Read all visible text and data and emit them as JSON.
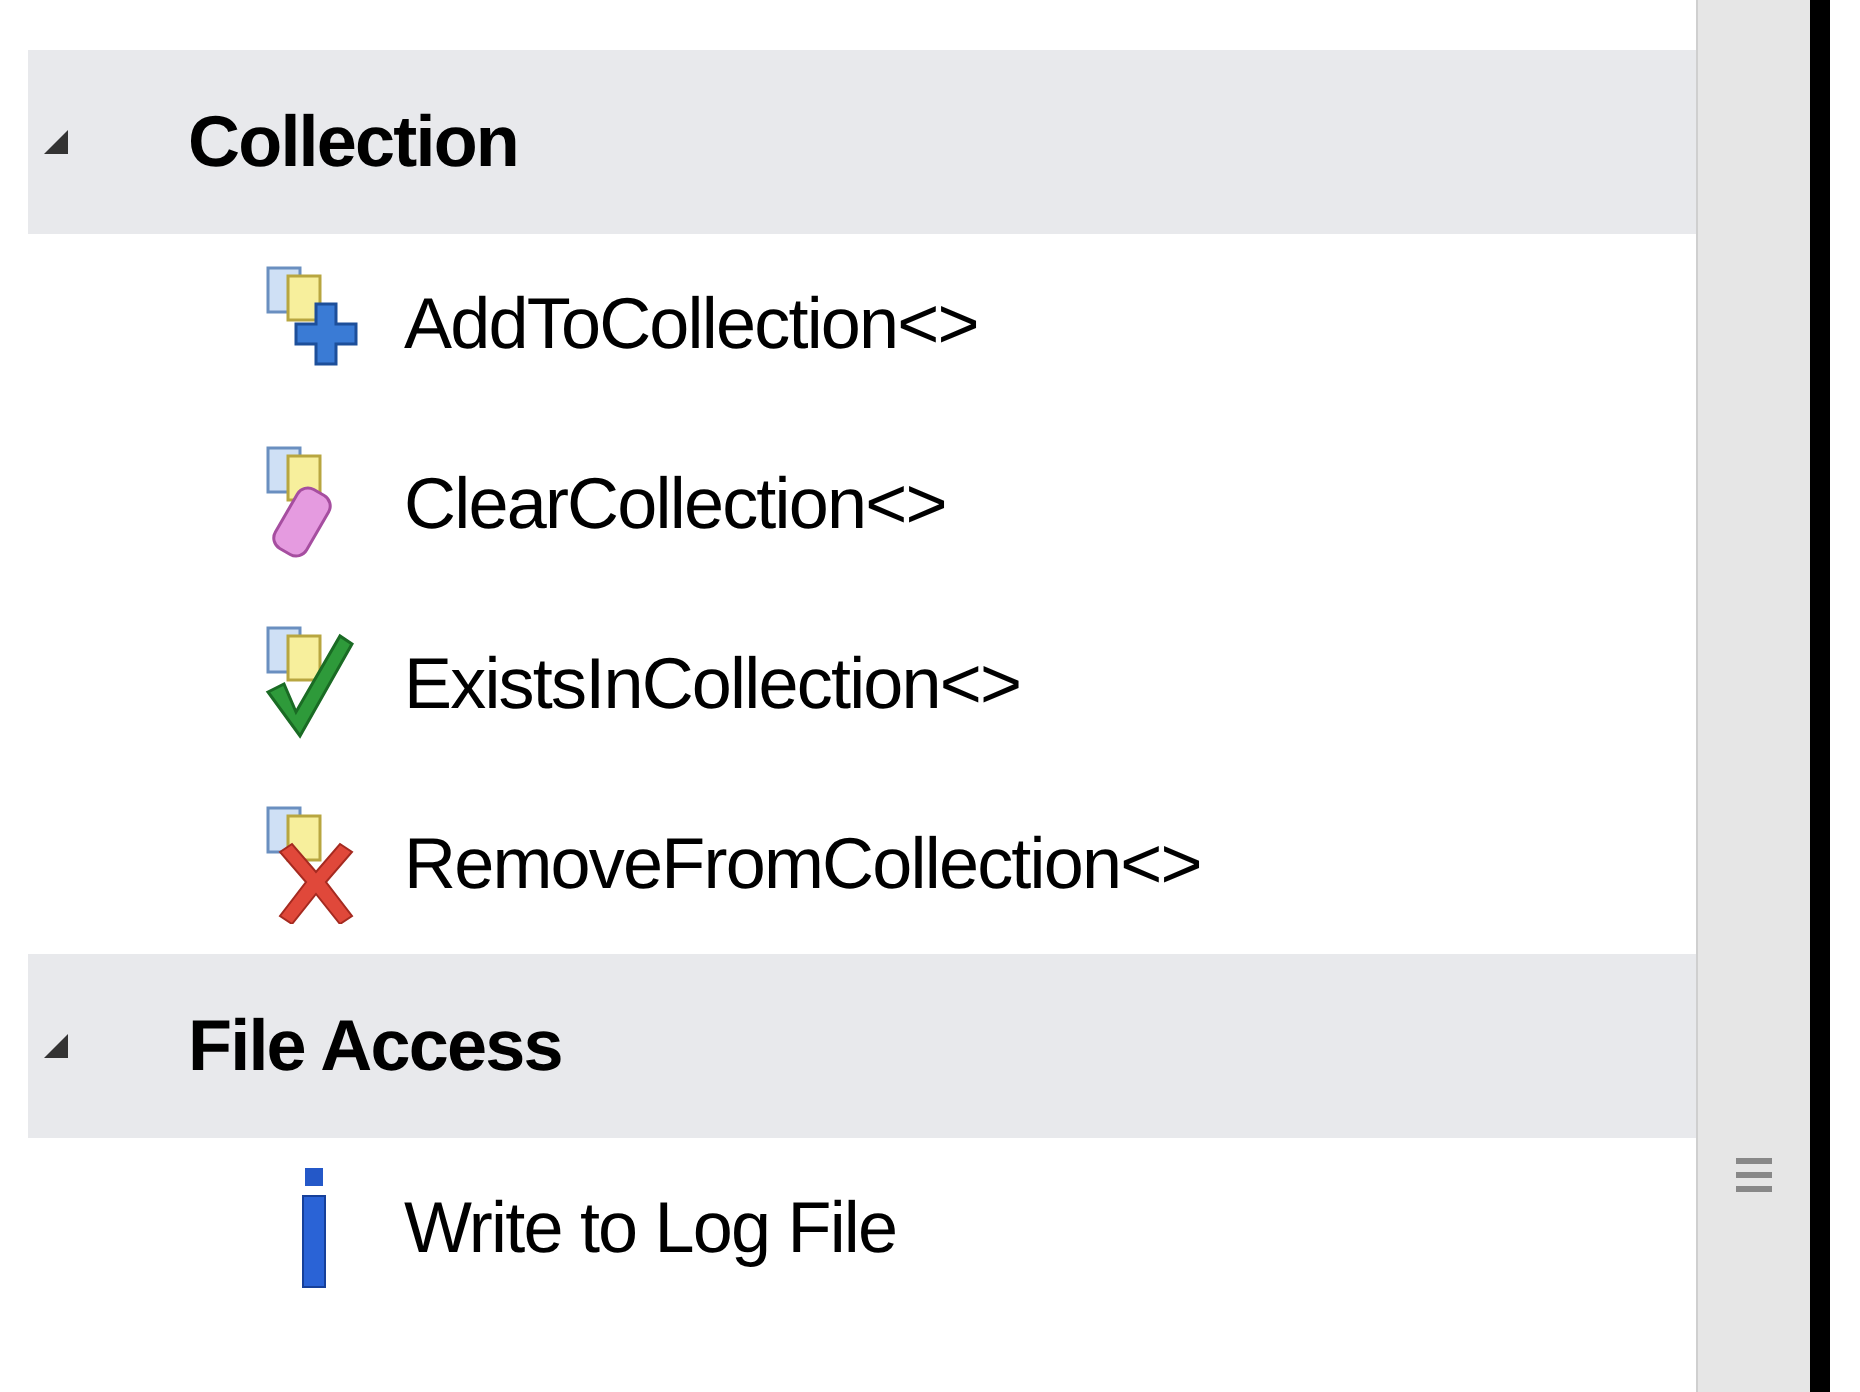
{
  "groups": [
    {
      "title": "Collection",
      "expanded": true,
      "items": [
        {
          "label": "AddToCollection<>",
          "kind": "add"
        },
        {
          "label": "ClearCollection<>",
          "kind": "clear"
        },
        {
          "label": "ExistsInCollection<>",
          "kind": "exists"
        },
        {
          "label": "RemoveFromCollection<>",
          "kind": "remove"
        }
      ]
    },
    {
      "title": "File Access",
      "expanded": true,
      "items": [
        {
          "label": "Write to Log File",
          "kind": "info"
        }
      ]
    }
  ]
}
